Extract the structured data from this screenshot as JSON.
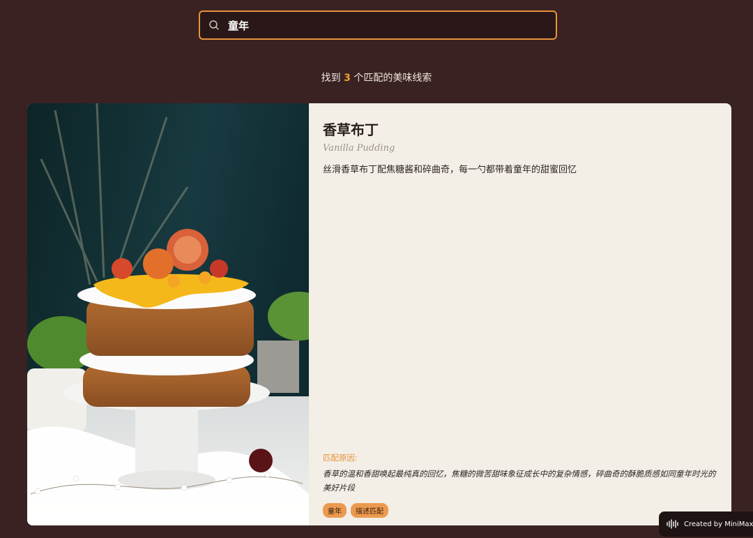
{
  "search": {
    "value": "童年",
    "icon": "search-icon"
  },
  "results": {
    "prefix": "找到",
    "count": "3",
    "suffix": "个匹配的美味线索"
  },
  "card": {
    "image_alt": "layered cake with orange slices",
    "title": "香草布丁",
    "subtitle": "Vanilla Pudding",
    "description": "丝滑香草布丁配焦糖酱和碎曲奇，每一勺都带着童年的甜蜜回忆",
    "match_label": "匹配原因:",
    "match_reason": "香草的温和香甜唤起最纯真的回忆，焦糖的微苦甜味象征成长中的复杂情感，碎曲奇的酥脆质感如同童年时光的美好片段",
    "tags": [
      "童年",
      "描述匹配"
    ]
  },
  "credit": {
    "label": "Created by MiniMax /"
  },
  "colors": {
    "background": "#3a2222",
    "accent": "#e8923a",
    "card_bg": "#f3efe7",
    "tag_bg": "#ec9a4f"
  }
}
